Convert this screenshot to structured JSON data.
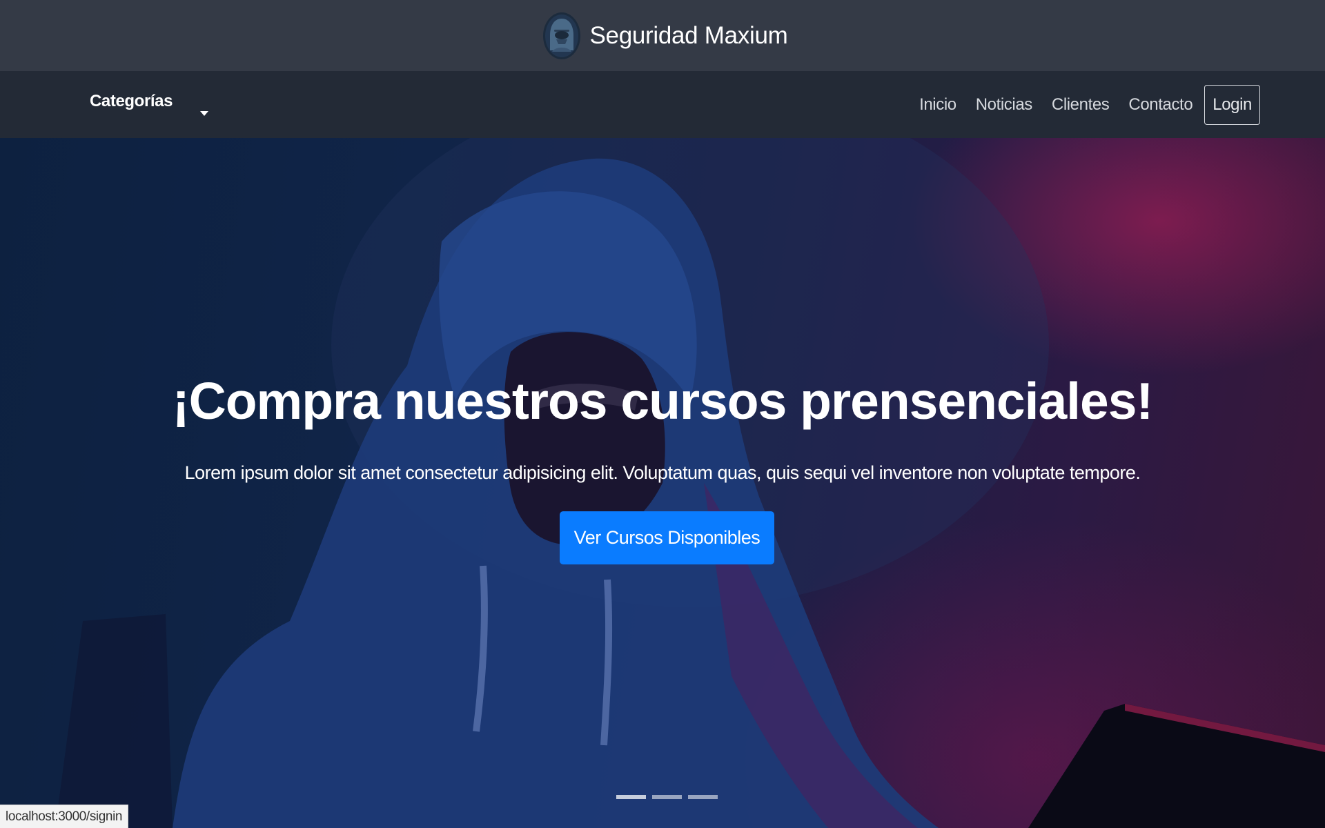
{
  "brand": {
    "name": "Seguridad Maxium",
    "logo_icon": "hooded-hacker-icon"
  },
  "navbar": {
    "categories_label": "Categorías",
    "links": [
      "Inicio",
      "Noticias",
      "Clientes",
      "Contacto"
    ],
    "login_label": "Login"
  },
  "hero": {
    "title": "¡Compra nuestros cursos prensenciales!",
    "text": "Lorem ipsum dolor sit amet consectetur adipisicing elit. Voluptatum quas, quis sequi vel inventore non voluptate tempore.",
    "cta_label": "Ver Cursos Disponibles",
    "slide_count": 3,
    "active_slide": 1
  },
  "status_bar": {
    "url": "localhost:3000/signin"
  },
  "colors": {
    "brand_bar": "#343a46",
    "navbar": "#232a36",
    "cta": "#0a7cff"
  }
}
